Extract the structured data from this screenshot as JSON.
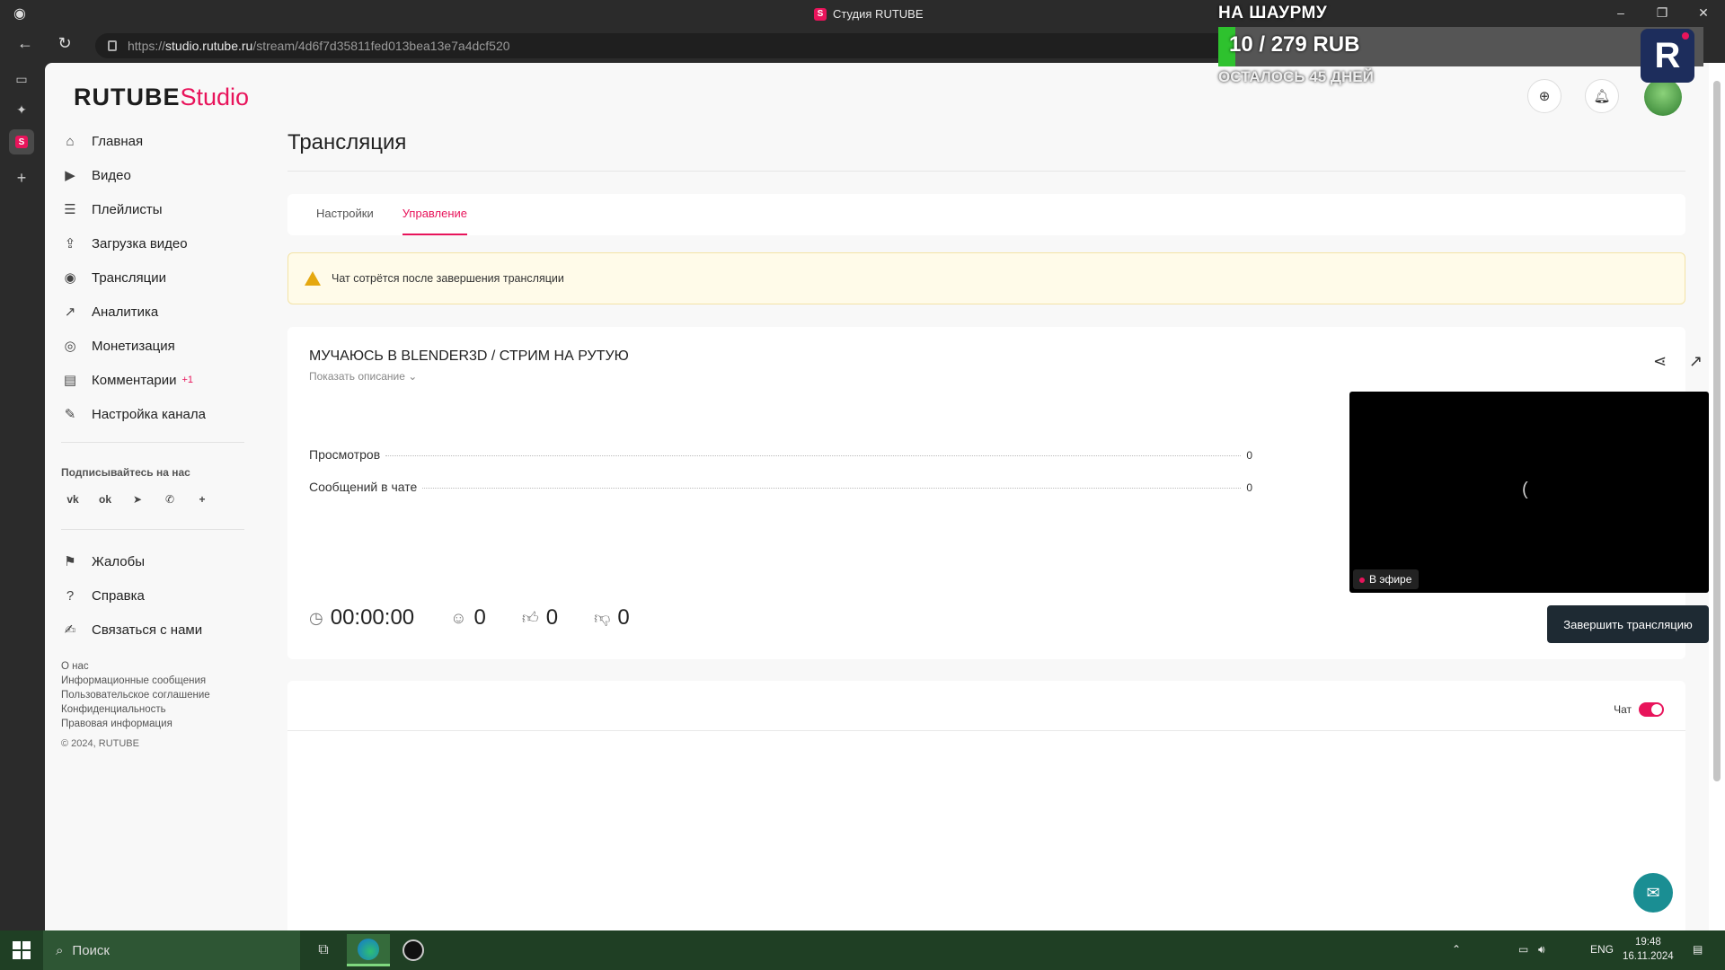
{
  "browser": {
    "window_title": "Студия RUTUBE",
    "url_prefix": "https://",
    "url_host": "studio.rutube.ru",
    "url_path": "/stream/4d6f7d35811fed013bea13e7a4dcf520"
  },
  "overlay": {
    "title": "НА ШАУРМУ",
    "amount": "10 / 279 RUB",
    "progress": 0.036,
    "remaining": "ОСТАЛОСЬ 45 ДНЕЙ",
    "logo": "R"
  },
  "logo": {
    "main": "RUTUBE",
    "accent": "Studio"
  },
  "sidebar": {
    "items": [
      {
        "label": "Главная",
        "icon": "home-icon"
      },
      {
        "label": "Видео",
        "icon": "video-icon"
      },
      {
        "label": "Плейлисты",
        "icon": "playlist-icon"
      },
      {
        "label": "Загрузка видео",
        "icon": "upload-icon"
      },
      {
        "label": "Трансляции",
        "icon": "broadcast-icon"
      },
      {
        "label": "Аналитика",
        "icon": "analytics-icon"
      },
      {
        "label": "Монетизация",
        "icon": "money-icon"
      },
      {
        "label": "Комментарии",
        "icon": "comments-icon",
        "badge": "+1"
      },
      {
        "label": "Настройка канала",
        "icon": "wand-icon"
      }
    ],
    "follow_title": "Подписывайтесь на нас",
    "socials": [
      "vk-icon",
      "ok-icon",
      "telegram-icon",
      "viber-icon",
      "plus-icon"
    ],
    "bottom_items": [
      {
        "label": "Жалобы",
        "icon": "flag-icon"
      },
      {
        "label": "Справка",
        "icon": "help-icon"
      },
      {
        "label": "Связаться с нами",
        "icon": "edit-icon"
      }
    ],
    "footer_links": [
      "О нас",
      "Информационные сообщения",
      "Пользовательское соглашение",
      "Конфиденциальность",
      "Правовая информация"
    ],
    "copyright": "© 2024, RUTUBE"
  },
  "main": {
    "title": "Трансляция",
    "tabs": [
      {
        "label": "Настройки",
        "active": false
      },
      {
        "label": "Управление",
        "active": true
      }
    ],
    "alert": "Чат сотрётся после завершения трансляции",
    "stream": {
      "title": "МУЧАЮСЬ В BLENDER3D / СТРИМ НА РУТУЮ",
      "show_description": "Показать описание",
      "stats": [
        {
          "label": "Просмотров",
          "value": "0"
        },
        {
          "label": "Сообщений в чате",
          "value": "0"
        }
      ],
      "duration": "00:00:00",
      "viewers": "0",
      "likes": "0",
      "dislikes": "0",
      "live_label": "В эфире",
      "end_button": "Завершить трансляцию"
    },
    "chat_label": "Чат",
    "chat_enabled": true
  },
  "taskbar": {
    "search_placeholder": "Поиск",
    "lang": "ENG",
    "time": "19:48",
    "date": "16.11.2024"
  },
  "colors": {
    "accent": "#e8145b",
    "dark_button": "#1e2a33"
  }
}
